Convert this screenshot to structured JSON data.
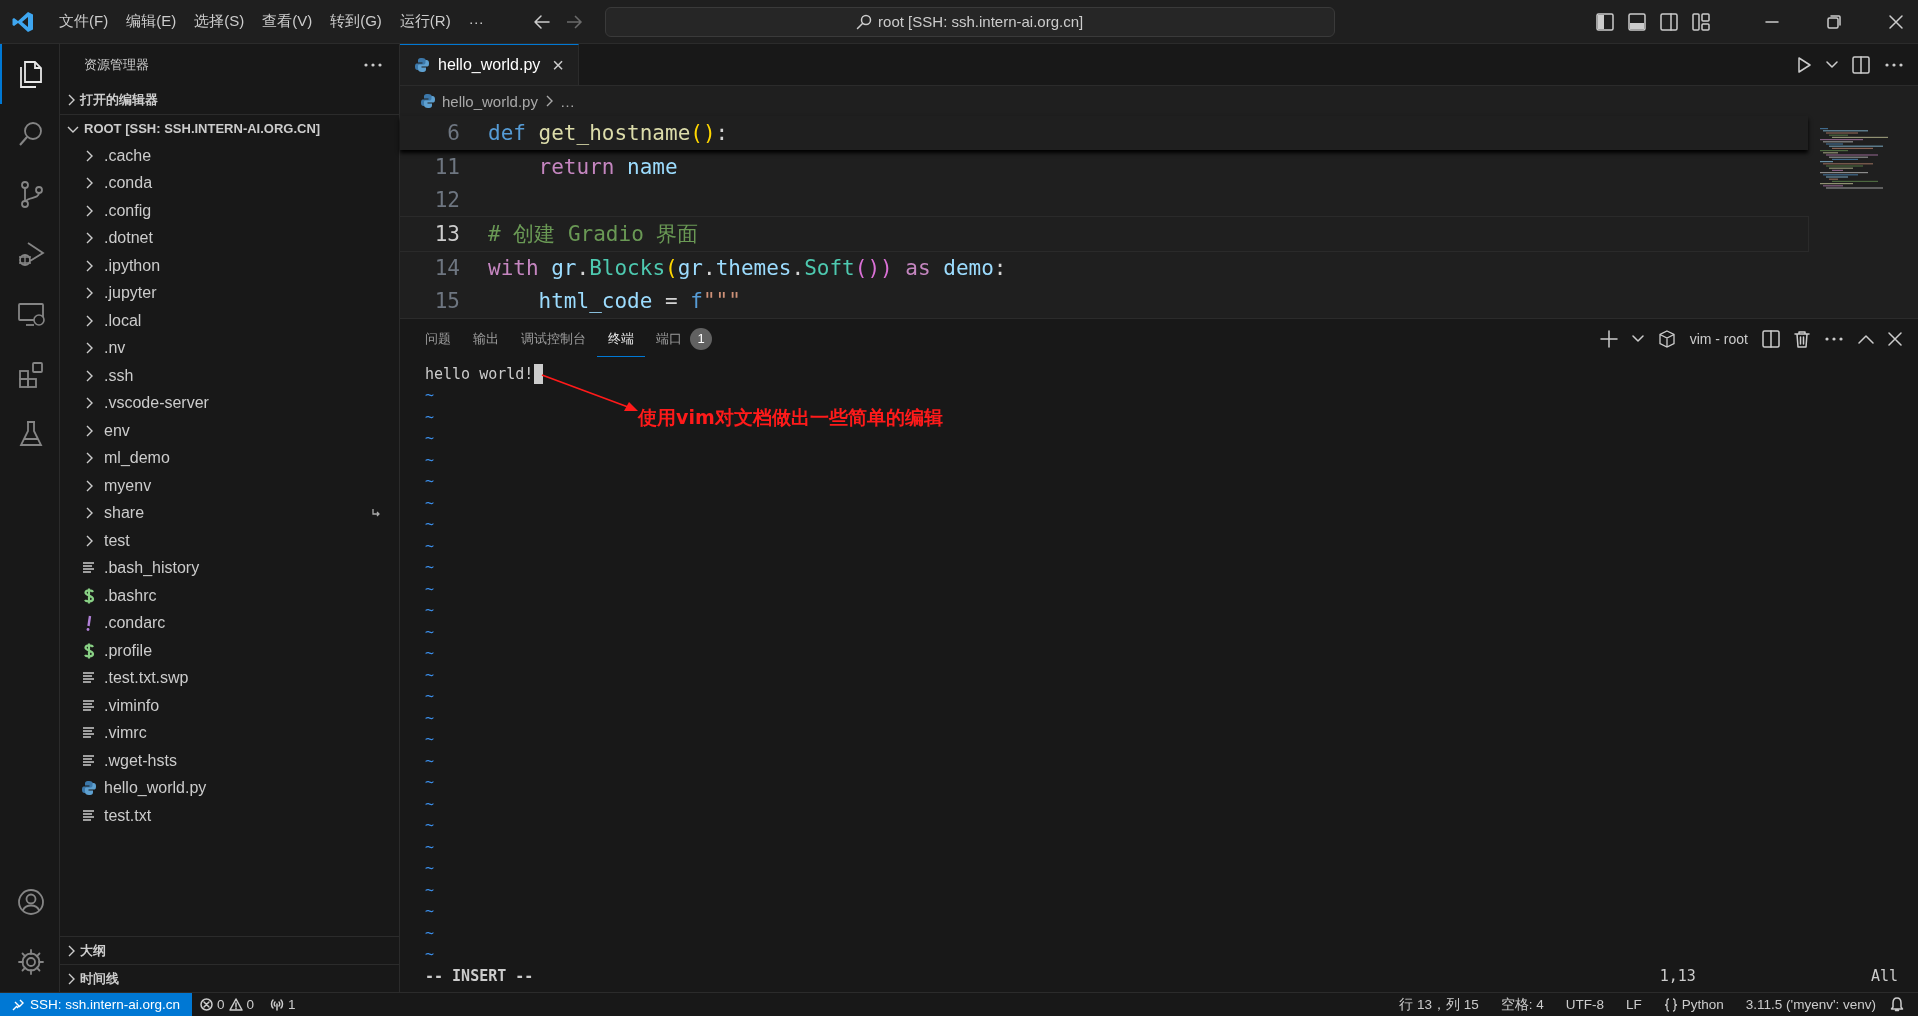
{
  "menu": [
    "文件(F)",
    "编辑(E)",
    "选择(S)",
    "查看(V)",
    "转到(G)",
    "运行(R)"
  ],
  "menu_more": "···",
  "command_center": "root [SSH: ssh.intern-ai.org.cn]",
  "activity_bar": [
    {
      "selected": true
    },
    {
      "selected": false
    },
    {
      "selected": false
    },
    {
      "selected": false
    },
    {
      "selected": false
    },
    {
      "selected": false
    },
    {
      "selected": false
    }
  ],
  "sidebar": {
    "title": "资源管理器",
    "open_editors": "打开的编辑器",
    "root": "ROOT [SSH: SSH.INTERN-AI.ORG.CN]",
    "items": [
      {
        "label": ".cache",
        "kind": "folder"
      },
      {
        "label": ".conda",
        "kind": "folder"
      },
      {
        "label": ".config",
        "kind": "folder"
      },
      {
        "label": ".dotnet",
        "kind": "folder"
      },
      {
        "label": ".ipython",
        "kind": "folder"
      },
      {
        "label": ".jupyter",
        "kind": "folder"
      },
      {
        "label": ".local",
        "kind": "folder"
      },
      {
        "label": ".nv",
        "kind": "folder"
      },
      {
        "label": ".ssh",
        "kind": "folder"
      },
      {
        "label": ".vscode-server",
        "kind": "folder"
      },
      {
        "label": "env",
        "kind": "folder"
      },
      {
        "label": "ml_demo",
        "kind": "folder"
      },
      {
        "label": "myenv",
        "kind": "folder"
      },
      {
        "label": "share",
        "kind": "folder",
        "symlink": true
      },
      {
        "label": "test",
        "kind": "folder"
      },
      {
        "label": ".bash_history",
        "kind": "text"
      },
      {
        "label": ".bashrc",
        "kind": "shell"
      },
      {
        "label": ".condarc",
        "kind": "config"
      },
      {
        "label": ".profile",
        "kind": "shell"
      },
      {
        "label": ".test.txt.swp",
        "kind": "text"
      },
      {
        "label": ".viminfo",
        "kind": "text"
      },
      {
        "label": ".vimrc",
        "kind": "text"
      },
      {
        "label": ".wget-hsts",
        "kind": "text"
      },
      {
        "label": "hello_world.py",
        "kind": "python"
      },
      {
        "label": "test.txt",
        "kind": "text"
      }
    ],
    "outline": "大纲",
    "timeline": "时间线"
  },
  "editor": {
    "tab": {
      "label": "hello_world.py",
      "close": "×"
    },
    "breadcrumb": [
      "hello_world.py",
      "…"
    ],
    "lines": [
      {
        "number": "6",
        "current": false,
        "sticky": true,
        "tokens": [
          {
            "t": "def ",
            "kind": "keyword"
          },
          {
            "t": "get_hostname",
            "kind": "function"
          },
          {
            "t": "()",
            "kind": "paren"
          },
          {
            "t": ":",
            "kind": "plain"
          }
        ]
      },
      {
        "number": "11",
        "current": false,
        "sticky": false,
        "tokens": [
          {
            "t": "    return ",
            "kind": "control"
          },
          {
            "t": "name",
            "kind": "variable"
          }
        ]
      },
      {
        "number": "12",
        "current": false,
        "sticky": false
      },
      {
        "number": "13",
        "current": true,
        "sticky": false,
        "tokens": [
          {
            "t": "# 创建 Gradio 界面",
            "kind": "comment"
          }
        ]
      },
      {
        "number": "14",
        "current": false,
        "sticky": false,
        "tokens": [
          {
            "t": "with ",
            "kind": "control"
          },
          {
            "t": "gr",
            "kind": "variable"
          },
          {
            "t": ".",
            "kind": "plain"
          },
          {
            "t": "Blocks",
            "kind": "class"
          },
          {
            "t": "(",
            "kind": "paren"
          },
          {
            "t": "gr",
            "kind": "variable"
          },
          {
            "t": ".",
            "kind": "plain"
          },
          {
            "t": "themes",
            "kind": "variable"
          },
          {
            "t": ".",
            "kind": "plain"
          },
          {
            "t": "Soft",
            "kind": "class"
          },
          {
            "t": "())",
            "kind": "paren2"
          },
          {
            "t": " as ",
            "kind": "control"
          },
          {
            "t": "demo",
            "kind": "variable"
          },
          {
            "t": ":",
            "kind": "plain"
          }
        ]
      },
      {
        "number": "15",
        "current": false,
        "sticky": false,
        "tokens": [
          {
            "t": "    html_code",
            "kind": "variable"
          },
          {
            "t": " = ",
            "kind": "plain"
          },
          {
            "t": "f",
            "kind": "keyword"
          },
          {
            "t": "\"\"\"",
            "kind": "string"
          }
        ]
      }
    ]
  },
  "panel": {
    "tabs": [
      {
        "label": "问题",
        "selected": false
      },
      {
        "label": "输出",
        "selected": false
      },
      {
        "label": "调试控制台",
        "selected": false
      },
      {
        "label": "终端",
        "selected": true
      },
      {
        "label": "端口",
        "selected": false,
        "badge": "1"
      }
    ],
    "terminal_name": "vim - root",
    "terminal": {
      "first_line": "hello world!",
      "tilde": "~",
      "mode": "-- INSERT --",
      "ruler": "1,13",
      "position": "All"
    },
    "annotation": "使用vim对文档做出一些简单的编辑"
  },
  "status_bar": {
    "remote": "SSH: ssh.intern-ai.org.cn",
    "errors": "0",
    "warnings": "0",
    "ports": "1",
    "right": [
      "行 13，列 15",
      "空格: 4",
      "UTF-8",
      "LF",
      "Python",
      "3.11.5 ('myenv': venv)"
    ]
  }
}
